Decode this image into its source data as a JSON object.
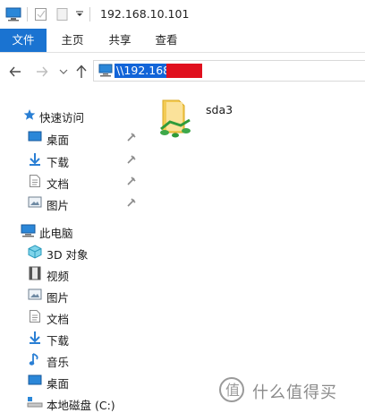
{
  "window": {
    "title": "192.168.10.101"
  },
  "ribbon": {
    "tabs": [
      {
        "label": "文件",
        "active": true
      },
      {
        "label": "主页",
        "active": false
      },
      {
        "label": "共享",
        "active": false
      },
      {
        "label": "查看",
        "active": false
      }
    ]
  },
  "address": {
    "value": "\\\\192.168"
  },
  "sidebar": {
    "quick_access": {
      "label": "快速访问",
      "items": [
        {
          "label": "桌面",
          "icon": "desktop-icon",
          "pinned": true
        },
        {
          "label": "下载",
          "icon": "download-icon",
          "pinned": true
        },
        {
          "label": "文档",
          "icon": "document-icon",
          "pinned": true
        },
        {
          "label": "图片",
          "icon": "pictures-icon",
          "pinned": true
        }
      ]
    },
    "this_pc": {
      "label": "此电脑",
      "items": [
        {
          "label": "3D 对象",
          "icon": "3d-objects-icon"
        },
        {
          "label": "视频",
          "icon": "video-icon"
        },
        {
          "label": "图片",
          "icon": "pictures-icon"
        },
        {
          "label": "文档",
          "icon": "document-icon"
        },
        {
          "label": "下载",
          "icon": "download-icon"
        },
        {
          "label": "音乐",
          "icon": "music-icon"
        },
        {
          "label": "桌面",
          "icon": "desktop-icon"
        },
        {
          "label": "本地磁盘 (C:)",
          "icon": "local-disk-icon"
        }
      ]
    }
  },
  "content": {
    "items": [
      {
        "label": "sda3",
        "icon": "shared-folder-icon"
      }
    ]
  },
  "watermark": {
    "text": "什么值得买"
  },
  "colors": {
    "accent": "#1a73d1",
    "selection": "#1264d8",
    "redaction": "#e0101e"
  }
}
